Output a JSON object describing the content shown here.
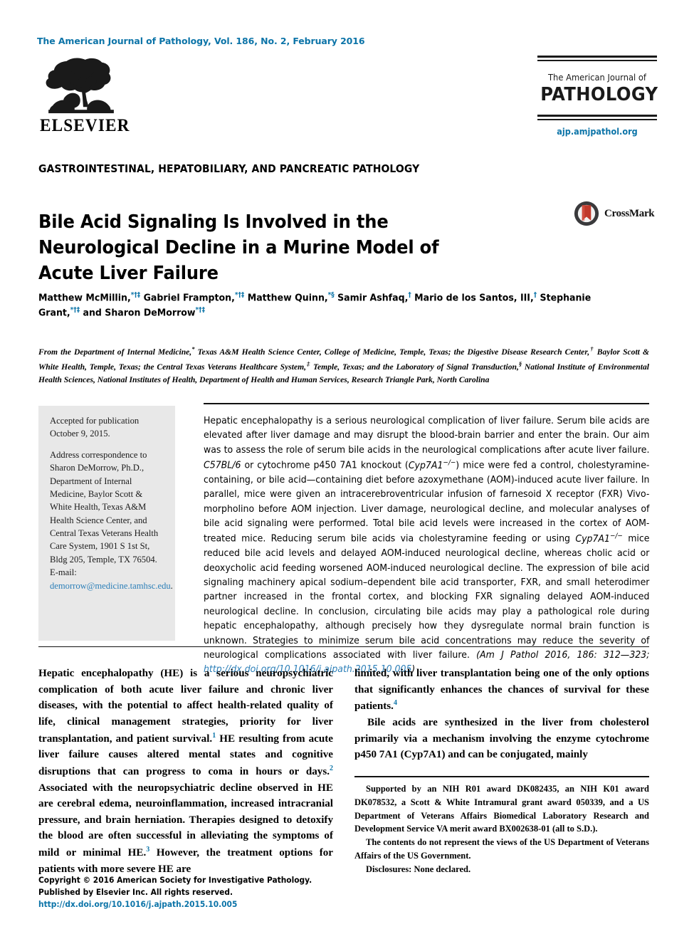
{
  "masthead": {
    "journal_citation": "The American Journal of Pathology, Vol. 186, No. 2, February 2016",
    "publisher_name": "ELSEVIER",
    "logo_sub": "The American Journal of",
    "logo_main": "PATHOLOGY",
    "logo_url": "ajp.amjpathol.org"
  },
  "article": {
    "section": "GASTROINTESTINAL, HEPATOBILIARY, AND PANCREATIC PATHOLOGY",
    "title": "Bile Acid Signaling Is Involved in the Neurological Decline in a Murine Model of Acute Liver Failure",
    "crossmark_label": "CrossMark",
    "authors_html": "Matthew McMillin,<sup>*†‡</sup> Gabriel Frampton,<sup>*†‡</sup> Matthew Quinn,<sup>*§</sup> Samir Ashfaq,<sup>†</sup> Mario de los Santos, III,<sup>†</sup> Stephanie Grant,<sup>*†‡</sup> and Sharon DeMorrow<sup>*†‡</sup>",
    "affiliations_html": "From the Department of Internal Medicine,<sup>*</sup> Texas A&amp;M Health Science Center, College of Medicine, Temple, Texas; the Digestive Disease Research Center,<sup>†</sup> Baylor Scott &amp; White Health, Temple, Texas; the Central Texas Veterans Healthcare System,<sup>‡</sup> Temple, Texas; and the Laboratory of Signal Transduction,<sup>§</sup> National Institute of Environmental Health Sciences, National Institutes of Health, Department of Health and Human Services, Research Triangle Park, North Carolina"
  },
  "sidebar": {
    "accepted": "Accepted for publication October 9, 2015.",
    "correspondence_html": "Address correspondence to Sharon DeMorrow, Ph.D., Department of Internal Medicine, Baylor Scott &amp; White Health, Texas A&amp;M Health Science Center, and Central Texas Veterans Health Care System, 1901 S 1st St, Bldg 205, Temple, TX 76504. E-mail: <span class=\"link-blue\">demorrow@medicine.tamhsc.edu</span>."
  },
  "abstract": {
    "text_html": "Hepatic encephalopathy is a serious neurological complication of liver failure. Serum bile acids are elevated after liver damage and may disrupt the blood-brain barrier and enter the brain. Our aim was to assess the role of serum bile acids in the neurological complications after acute liver failure. <i>C57BL/6</i> or cytochrome p450 7A1 knockout (<i>Cyp7A1<sup>−/−</sup></i>) mice were fed a control, cholestyramine-containing, or bile acid—containing diet before azoxymethane (AOM)-induced acute liver failure. In parallel, mice were given an intracerebroventricular infusion of farnesoid X receptor (FXR) Vivo-morpholino before AOM injection. Liver damage, neurological decline, and molecular analyses of bile acid signaling were performed. Total bile acid levels were increased in the cortex of AOM-treated mice. Reducing serum bile acids via cholestyramine feeding or using <i>Cyp7A1<sup>−/−</sup></i> mice reduced bile acid levels and delayed AOM-induced neurological decline, whereas cholic acid or deoxycholic acid feeding worsened AOM-induced neurological decline. The expression of bile acid signaling machinery apical sodium–dependent bile acid transporter, FXR, and small heterodimer partner increased in the frontal cortex, and blocking FXR signaling delayed AOM-induced neurological decline. In conclusion, circulating bile acids may play a pathological role during hepatic encephalopathy, although precisely how they dysregulate normal brain function is unknown. Strategies to minimize serum bile acid concentrations may reduce the severity of neurological complications associated with liver failure. <span class=\"cite\">(Am J Pathol 2016, 186: 312—323; <span class=\"link-blue\">http://dx.doi.org/10.1016/j.ajpath.2015.10.005</span>)</span>"
  },
  "body": {
    "left_column_html": "Hepatic encephalopathy (HE) is a serious neuropsychiatric complication of both acute liver failure and chronic liver diseases, with the potential to affect health-related quality of life, clinical management strategies, priority for liver transplantation, and patient survival.<sup>1</sup> HE resulting from acute liver failure causes altered mental states and cognitive disruptions that can progress to coma in hours or days.<sup>2</sup> Associated with the neuropsychiatric decline observed in HE are cerebral edema, neuroinflammation, increased intracranial pressure, and brain herniation. Therapies designed to detoxify the blood are often successful in alleviating the symptoms of mild or minimal HE.<sup>3</sup> However, the treatment options for patients with more severe HE are",
    "right_column_para1_html": "limited, with liver transplantation being one of the only options that significantly enhances the chances of survival for these patients.<sup>4</sup>",
    "right_column_para2_html": "Bile acids are synthesized in the liver from cholesterol primarily via a mechanism involving the enzyme cytochrome p450 7A1 (Cyp7A1) and can be conjugated, mainly"
  },
  "footnotes": {
    "support": "Supported by an NIH R01 award DK082435, an NIH K01 award DK078532, a Scott & White Intramural grant award 050339, and a US Department of Veterans Affairs Biomedical Laboratory Research and Development Service VA merit award BX002638-01 (all to S.D.).",
    "views": "The contents do not represent the views of the US Department of Veterans Affairs of the US Government.",
    "disclosures": "Disclosures: None declared."
  },
  "footer": {
    "copyright": "Copyright © 2016 American Society for Investigative Pathology.",
    "published": "Published by Elsevier Inc. All rights reserved.",
    "doi": "http://dx.doi.org/10.1016/j.ajpath.2015.10.005"
  },
  "colors": {
    "link_blue": "#0c74a8",
    "sidebar_bg": "#e8e8e8",
    "crossmark_red": "#c0392b"
  }
}
